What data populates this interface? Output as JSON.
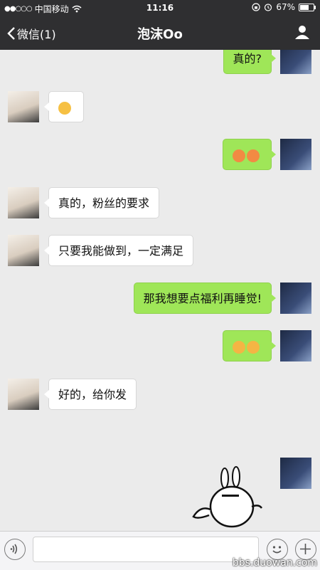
{
  "status": {
    "carrier": "中国移动",
    "time": "11:16",
    "battery": "67%"
  },
  "nav": {
    "back_label": "微信(1)",
    "title": "泡沫Oo"
  },
  "messages": [
    {
      "sender": "me",
      "text": "真的?"
    },
    {
      "sender": "other",
      "emoji": [
        "smile"
      ]
    },
    {
      "sender": "me",
      "emoji": [
        "angry",
        "angry"
      ]
    },
    {
      "sender": "other",
      "text": "真的，粉丝的要求"
    },
    {
      "sender": "other",
      "text": "只要我能做到，一定满足"
    },
    {
      "sender": "me",
      "text": "那我想要点福利再睡觉!"
    },
    {
      "sender": "me",
      "emoji": [
        "grin",
        "grin"
      ]
    },
    {
      "sender": "other",
      "text": "好的，给你发"
    },
    {
      "sender": "me",
      "sticker": "rabbit-sticker"
    }
  ],
  "input": {
    "placeholder": ""
  },
  "watermark": "bbs.duowan.com"
}
